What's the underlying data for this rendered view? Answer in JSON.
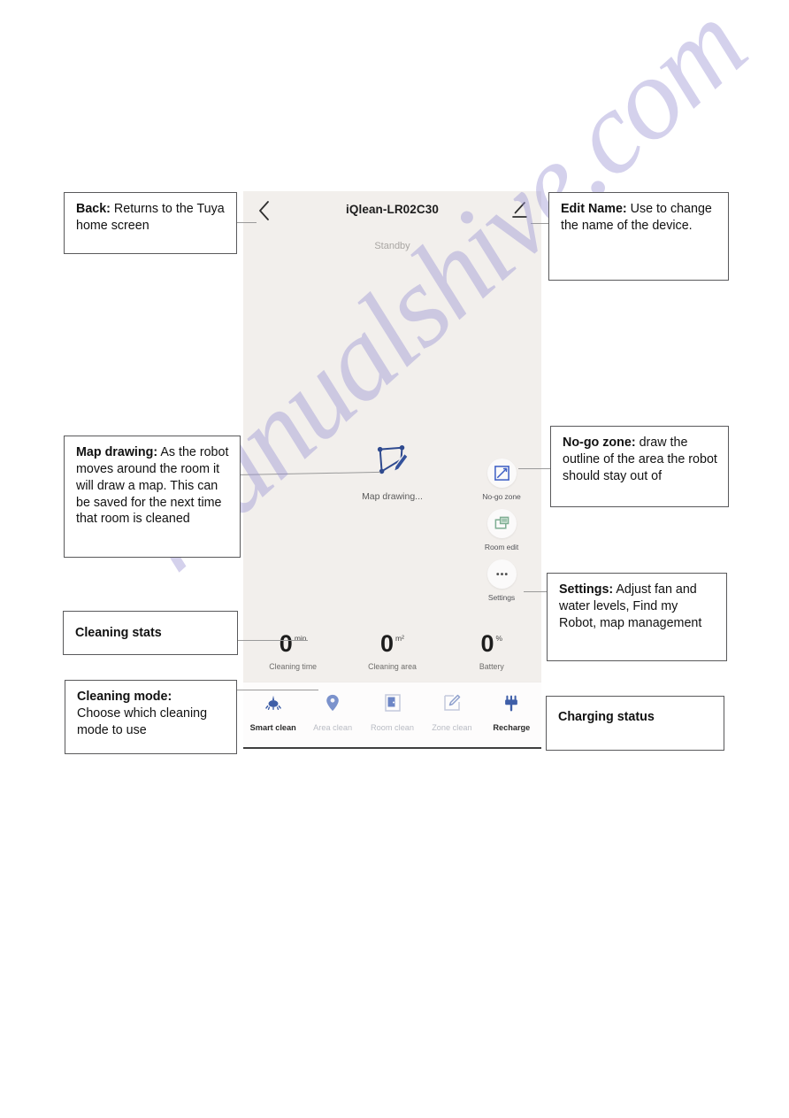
{
  "app": {
    "device_title": "iQlean-LR02C30",
    "status": "Standby",
    "back_icon": "chevron-left-icon",
    "edit_icon": "pencil-edit-icon",
    "map_drawing_label": "Map drawing...",
    "map_drawing_icon": "polygon-pencil-icon"
  },
  "side_tools": [
    {
      "label": "No-go zone",
      "icon": "no-go-zone-icon",
      "color": "#3d5ec4"
    },
    {
      "label": "Room edit",
      "icon": "room-edit-icon",
      "color": "#7fae93"
    },
    {
      "label": "Settings",
      "icon": "ellipsis-icon",
      "color": "#4a4a4a"
    }
  ],
  "stats": [
    {
      "value": "0",
      "unit": "min",
      "caption": "Cleaning time"
    },
    {
      "value": "0",
      "unit": "m²",
      "caption": "Cleaning area"
    },
    {
      "value": "0",
      "unit": "%",
      "caption": "Battery"
    }
  ],
  "tabs": [
    {
      "label": "Smart clean",
      "icon": "robot-vacuum-icon",
      "active": true
    },
    {
      "label": "Area clean",
      "icon": "map-pin-icon",
      "active": false
    },
    {
      "label": "Room clean",
      "icon": "room-document-icon",
      "active": false
    },
    {
      "label": "Zone clean",
      "icon": "zone-square-pencil-icon",
      "active": false
    },
    {
      "label": "Recharge",
      "icon": "power-plug-icon",
      "active": true
    }
  ],
  "callouts": {
    "back": {
      "title": "Back:",
      "body": " Returns to the Tuya home screen"
    },
    "edit_name": {
      "title": "Edit Name:",
      "body": " Use to change the name of the device."
    },
    "map_drawing": {
      "title": "Map drawing:",
      "body": " As the robot moves around the room it will draw a map. This can be saved for the next time that room is cleaned"
    },
    "no_go_zone": {
      "title": "No-go zone:",
      "body": " draw the outline of the area the robot should stay out of"
    },
    "settings": {
      "title": "Settings:",
      "body": " Adjust fan and water levels, Find my Robot, map management"
    },
    "cleaning_stats": {
      "title": "Cleaning stats",
      "body": ""
    },
    "cleaning_mode": {
      "title": "Cleaning mode:",
      "body": " Choose which cleaning mode to use"
    },
    "charging_status": {
      "title": "Charging status",
      "body": ""
    }
  },
  "watermark": {
    "text": "manualshive.com"
  }
}
